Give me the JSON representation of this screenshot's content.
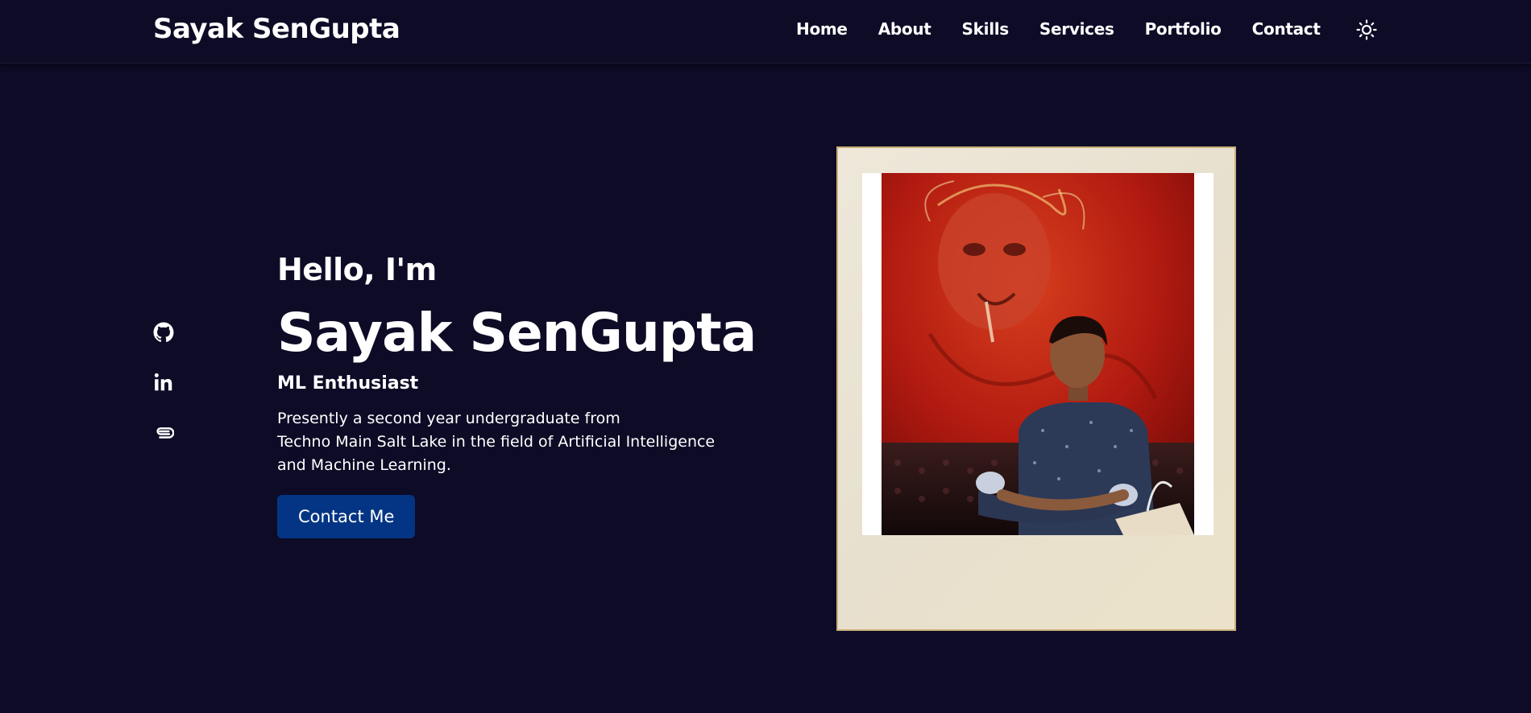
{
  "header": {
    "logo": "Sayak SenGupta",
    "nav": [
      "Home",
      "About",
      "Skills",
      "Services",
      "Portfolio",
      "Contact"
    ],
    "theme_icon": "sun-icon"
  },
  "social": [
    {
      "name": "github",
      "icon": "github-icon"
    },
    {
      "name": "linkedin",
      "icon": "linkedin-icon"
    },
    {
      "name": "resume",
      "icon": "paperclip-icon"
    }
  ],
  "hero": {
    "greeting": "Hello, I'm",
    "name": "Sayak SenGupta",
    "subtitle": "ML Enthusiast",
    "description_lines": [
      "Presently a second year undergraduate from",
      "Techno Main Salt Lake in the field of Artificial Intelligence",
      "and Machine Learning."
    ],
    "cta_label": "Contact Me"
  },
  "colors": {
    "background": "#0d0b26",
    "button": "#043584",
    "text": "#ffffff",
    "frame": "#e9e3d2",
    "frame_border": "#c9b07a"
  }
}
